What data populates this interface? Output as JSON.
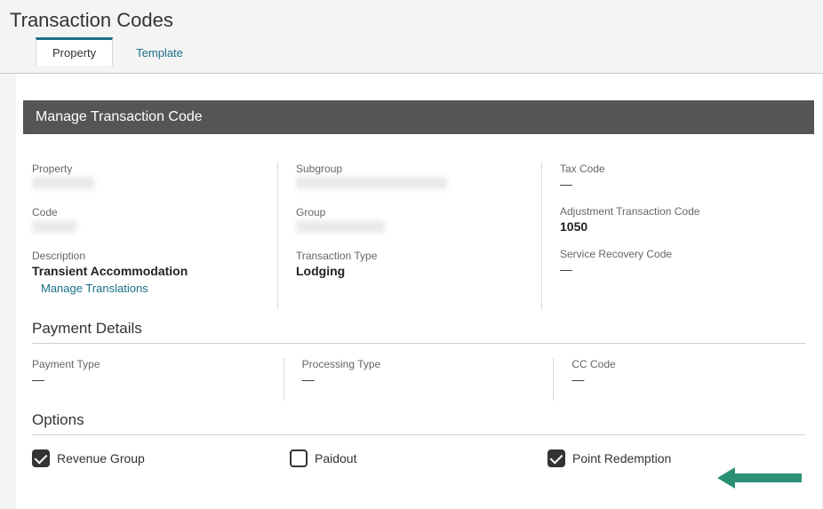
{
  "page": {
    "title": "Transaction Codes"
  },
  "tabs": {
    "property": "Property",
    "template": "Template"
  },
  "banner": {
    "title": "Manage Transaction Code"
  },
  "details": {
    "property": {
      "label": "Property"
    },
    "code": {
      "label": "Code"
    },
    "description": {
      "label": "Description",
      "value": "Transient Accommodation",
      "link": "Manage Translations"
    },
    "subgroup": {
      "label": "Subgroup"
    },
    "group": {
      "label": "Group"
    },
    "transaction_type": {
      "label": "Transaction Type",
      "value": "Lodging"
    },
    "tax_code": {
      "label": "Tax Code",
      "value": "—"
    },
    "adjustment_code": {
      "label": "Adjustment Transaction Code",
      "value": "1050"
    },
    "service_recovery": {
      "label": "Service Recovery Code",
      "value": "—"
    }
  },
  "payment": {
    "heading": "Payment Details",
    "payment_type": {
      "label": "Payment Type",
      "value": "—"
    },
    "processing_type": {
      "label": "Processing Type",
      "value": "—"
    },
    "cc_code": {
      "label": "CC Code",
      "value": "—"
    }
  },
  "options": {
    "heading": "Options",
    "revenue_group": "Revenue Group",
    "paidout": "Paidout",
    "point_redemption": "Point Redemption"
  }
}
